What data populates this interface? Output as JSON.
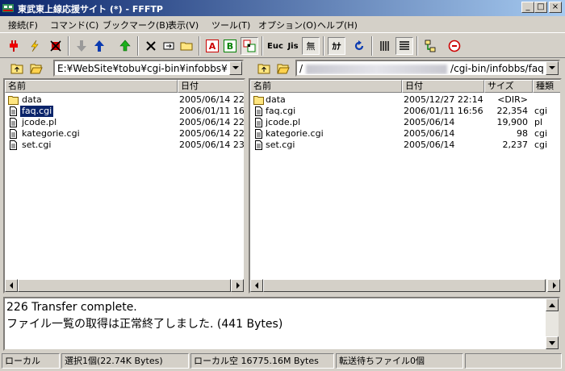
{
  "window": {
    "title": "東武東上線応援サイト (*) - FFFTP"
  },
  "menu": {
    "items": [
      "接続(F)",
      "コマンド(C)",
      "ブックマーク(B)",
      "表示(V)",
      "ツール(T)",
      "オプション(O)",
      "ヘルプ(H)"
    ]
  },
  "toolbar": {
    "icons": [
      "connect-icon",
      "quick-connect-icon",
      "disconnect-icon",
      "download-icon",
      "upload-icon",
      "mirror-upload-icon",
      "delete-icon",
      "rename-icon",
      "mkdir-icon",
      "ascii-mode-icon",
      "binary-mode-icon",
      "auto-mode-icon",
      "euc-icon",
      "jis-icon",
      "no-convert-icon",
      "kana-convert-icon",
      "refresh-icon",
      "list-view-icon",
      "detail-view-icon",
      "sync-icon",
      "stop-icon"
    ],
    "ascii_label": "A",
    "binary_label": "B",
    "euc_label": "Euc",
    "jis_label": "Jis",
    "noconv_label": "無",
    "kana_label": "ｶﾅ"
  },
  "local": {
    "path": "E:¥WebSite¥tobu¥cgi-bin¥infobbs¥faq",
    "headers": {
      "name": "名前",
      "date": "日付"
    },
    "files": [
      {
        "name": "data",
        "date": "2005/06/14 22:",
        "type": "folder",
        "selected": false
      },
      {
        "name": "faq.cgi",
        "date": "2006/01/11 16:",
        "type": "file",
        "selected": true
      },
      {
        "name": "jcode.pl",
        "date": "2005/06/14 22:",
        "type": "file",
        "selected": false
      },
      {
        "name": "kategorie.cgi",
        "date": "2005/06/14 22:",
        "type": "file",
        "selected": false
      },
      {
        "name": "set.cgi",
        "date": "2005/06/14 23:",
        "type": "file",
        "selected": false
      }
    ]
  },
  "remote": {
    "path_prefix": "/",
    "path_suffix": "/cgi-bin/infobbs/faq",
    "headers": {
      "name": "名前",
      "date": "日付",
      "size": "サイズ",
      "type": "種類"
    },
    "files": [
      {
        "name": "data",
        "date": "2005/12/27 22:14",
        "size": "<DIR>",
        "kind": "",
        "type": "folder"
      },
      {
        "name": "faq.cgi",
        "date": "2006/01/11 16:56",
        "size": "22,354",
        "kind": "cgi",
        "type": "file"
      },
      {
        "name": "jcode.pl",
        "date": "2005/06/14",
        "size": "19,900",
        "kind": "pl",
        "type": "file"
      },
      {
        "name": "kategorie.cgi",
        "date": "2005/06/14",
        "size": "98",
        "kind": "cgi",
        "type": "file"
      },
      {
        "name": "set.cgi",
        "date": "2005/06/14",
        "size": "2,237",
        "kind": "cgi",
        "type": "file"
      }
    ]
  },
  "log": {
    "lines": [
      "226 Transfer complete.",
      "ファイル一覧の取得は正常終了しました. (441 Bytes)"
    ]
  },
  "status": {
    "mode": "ローカル",
    "selection": "選択1個(22.74K Bytes)",
    "free": "ローカル空 16775.16M Bytes",
    "queue": "転送待ちファイル0個"
  }
}
